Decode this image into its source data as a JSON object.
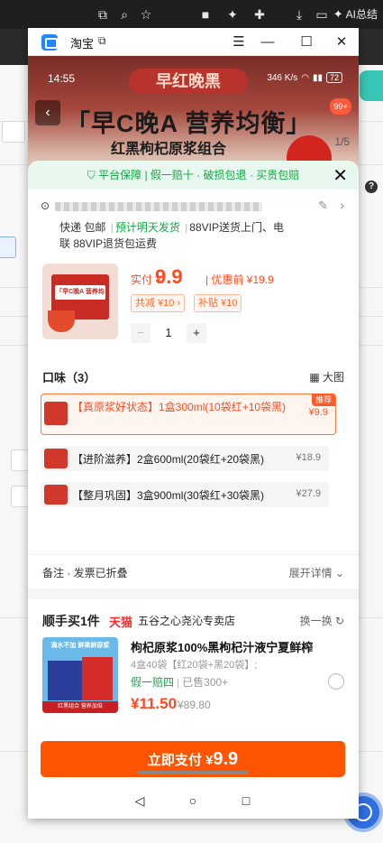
{
  "browser": {
    "ai_label": "AI总结"
  },
  "window": {
    "title": "淘宝"
  },
  "phone": {
    "time": "14:55",
    "net_speed": "346 K/s",
    "battery": "72",
    "promo_pill": "早红晚黑",
    "promo_title": "「早C晚A 营养均衡」",
    "promo_sub": "红黑枸杞原浆组合",
    "badge": "99+",
    "counter": "1/5"
  },
  "guarantee": "平台保障 | 假一赔十 · 破损包退 · 买贵包赔",
  "shipping": {
    "part1": "快递 包邮",
    "highlight": "预计明天发货",
    "part2": "88VIP送货上门、电联 88VIP退货包运费"
  },
  "price": {
    "label": "实付 ¥",
    "value": "9.9",
    "pre": "| 优惠前 ¥19.9",
    "tag1": "共减 ¥10 ›",
    "tag2": "补贴 ¥10",
    "qty": "1"
  },
  "flavor": {
    "heading": "口味（3）",
    "bigview": "大图",
    "options": [
      {
        "text": "【真原浆好状态】1盒300ml(10袋红+10袋黑)",
        "price": "¥9.9",
        "badge": "推荐"
      },
      {
        "text": "【进阶滋养】2盒600ml(20袋红+20袋黑)",
        "price": "¥18.9"
      },
      {
        "text": "【整月巩固】3盒900ml(30袋红+30袋黑)",
        "price": "¥27.9"
      }
    ]
  },
  "remark": {
    "label": "备注 · 发票已折叠",
    "expand": "展开详情"
  },
  "upsell": {
    "heading": "顺手买1件",
    "brand": "天猫",
    "shop": "五谷之心尧沁专卖店",
    "swap": "换一换",
    "image_text": "滴水不加 鲜果鲜原浆",
    "image_footer": "红黑组合 营养加倍",
    "name": "枸杞原浆100%黑枸杞汁液宁夏鲜榨",
    "spec": "4盒40袋【红20袋+黑20袋】;",
    "promo": "假一赔四",
    "sold": "已售300+",
    "price": "¥11.50",
    "orig": "¥89.80"
  },
  "pay": {
    "label": "立即支付 ¥",
    "value": "9.9"
  },
  "colors": {
    "accent": "#ff5400",
    "green": "#13a646",
    "price": "#ff4b1f"
  }
}
